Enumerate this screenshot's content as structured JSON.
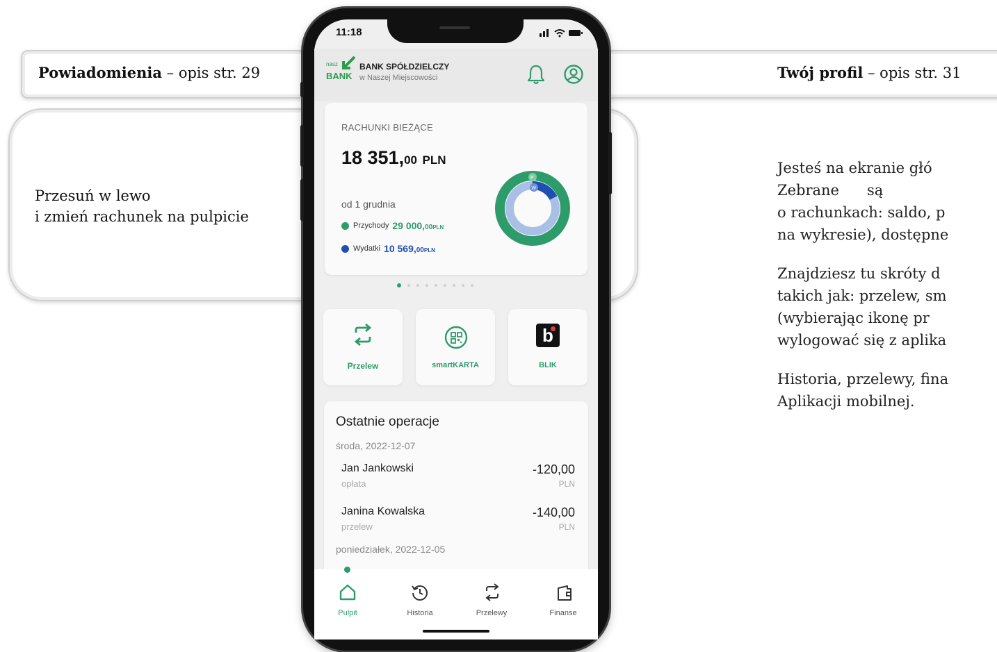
{
  "callouts": {
    "notifications": {
      "bold": "Powiadomienia",
      "rest": " – opis str. 29"
    },
    "profile": {
      "bold": "Twój profil",
      "rest": " – opis str. 31"
    },
    "swipe": {
      "line1": "Przesuń w lewo",
      "line2": "i zmień rachunek na pulpicie"
    }
  },
  "status_bar": {
    "time": "11:18",
    "icons": "▐▐ ◠ ▬"
  },
  "bank": {
    "nasz": "nasz",
    "bank": "BANK",
    "name": "BANK SPÓŁDZIELCZY",
    "subtitle": "w Naszej Miejscowości"
  },
  "header_icons": {
    "bell": "bell-icon",
    "profile": "user-circle-icon"
  },
  "account": {
    "title": "RACHUNKI BIEŻĄCE",
    "balance": "18 351,",
    "balance_decimals": "00",
    "currency": "PLN",
    "since": "od 1 grudnia",
    "income_label": "Przychody",
    "income_value": "29 000,",
    "income_decimals": "00",
    "income_currency": "PLN",
    "expense_label": "Wydatki",
    "expense_value": "10 569,",
    "expense_decimals": "00",
    "expense_currency": "PLN",
    "donut_marker_p": "P",
    "donut_marker_w": "W",
    "income_color": "#2e9b6b",
    "expense_color": "#1f4fb0",
    "pager_count": 9,
    "pager_active": 0
  },
  "shortcuts": [
    {
      "label": "Przelew",
      "icon": "transfer-icon"
    },
    {
      "label": "smartKARTA",
      "icon": "qr-card-icon"
    },
    {
      "label": "BLIK",
      "icon": "blik-icon",
      "glyph": "b"
    }
  ],
  "operations": {
    "title": "Ostatnie operacje",
    "groups": [
      {
        "date": "środa, 2022-12-07",
        "items": [
          {
            "name": "Jan Jankowski",
            "type": "opłata",
            "amount": "-120,00",
            "currency": "PLN"
          },
          {
            "name": "Janina Kowalska",
            "type": "przelew",
            "amount": "-140,00",
            "currency": "PLN"
          }
        ]
      },
      {
        "date": "poniedziałek, 2022-12-05",
        "items": []
      }
    ]
  },
  "nav": [
    {
      "label": "Pulpit",
      "icon": "home-icon",
      "active": true
    },
    {
      "label": "Historia",
      "icon": "history-icon",
      "active": false
    },
    {
      "label": "Przelewy",
      "icon": "transfer-icon",
      "active": false
    },
    {
      "label": "Finanse",
      "icon": "finance-icon",
      "active": false
    }
  ],
  "description": {
    "p1": [
      "Jesteś na ekranie głó",
      "Zebrane      są      ",
      "o rachunkach: saldo, p",
      "na wykresie), dostępne"
    ],
    "p2": [
      "Znajdziesz tu skróty d",
      "takich jak: przelew, sm",
      "(wybierając ikonę pr",
      "wylogować się z aplika"
    ],
    "p3": [
      "Historia, przelewy, fina",
      "Aplikacji mobilnej."
    ]
  }
}
